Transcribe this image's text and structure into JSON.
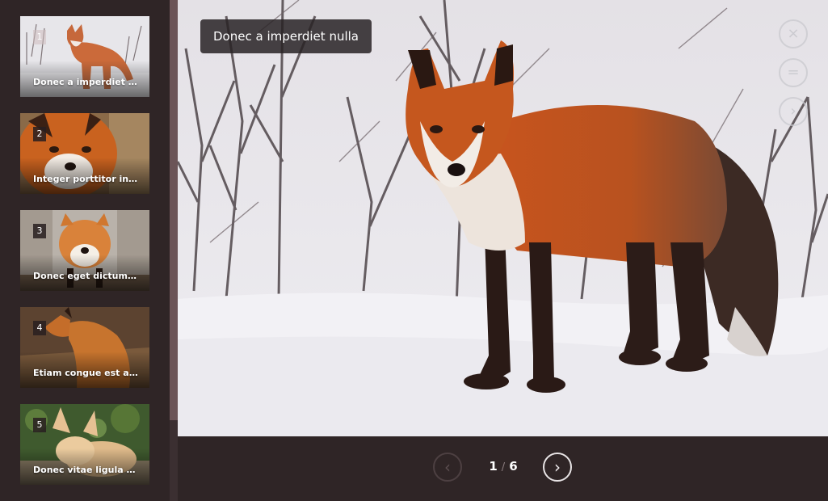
{
  "gallery": {
    "current_title": "Donec a imperdiet nulla",
    "counter": {
      "current": "1",
      "separator": "/",
      "total": "6"
    },
    "thumbnails": [
      {
        "number": "1",
        "caption": "Donec a imperdiet nu..."
      },
      {
        "number": "2",
        "caption": "Integer porttitor inter..."
      },
      {
        "number": "3",
        "caption": "Donec eget dictum nisi"
      },
      {
        "number": "4",
        "caption": "Etiam congue est a cu..."
      },
      {
        "number": "5",
        "caption": "Donec vitae ligula id ..."
      }
    ]
  },
  "controls": {
    "close_icon": "×",
    "menu_icon": "=",
    "next_icon": "›",
    "prev_icon": "‹",
    "bottom_next_icon": "›"
  },
  "colors": {
    "background": "#2f2526",
    "accent": "#d5602a"
  }
}
